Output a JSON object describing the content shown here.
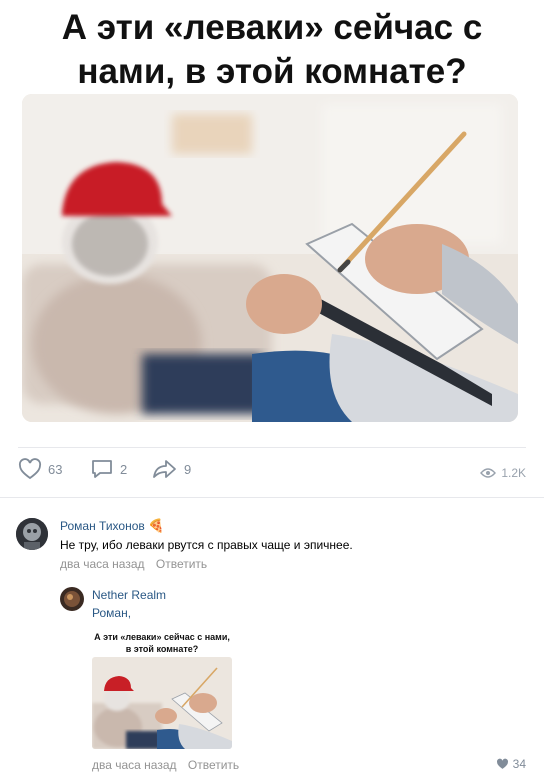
{
  "post": {
    "meme_caption": "А эти «леваки» сейчас с нами, в этой комнате?",
    "image_icon": "meme-photo-therapist"
  },
  "actions": {
    "likes": "63",
    "comments": "2",
    "shares": "9",
    "views": "1.2K"
  },
  "comments": [
    {
      "author": "Роман Тихонов",
      "badge_icon": "pizza-emoji",
      "text": "Не тру, ибо леваки рвутся с правых чаще и эпичнее.",
      "time": "два часа назад",
      "reply_label": "Ответить"
    },
    {
      "author": "Nether Realm",
      "text": "Роман,",
      "attachment_caption": "А эти «леваки» сейчас с нами, в этой комнате?",
      "time": "два часа назад",
      "reply_label": "Ответить",
      "likes": "34"
    }
  ],
  "colors": {
    "link": "#2a5885",
    "meta": "#939393",
    "icon": "#818c99",
    "divider": "#e7e8ec"
  }
}
